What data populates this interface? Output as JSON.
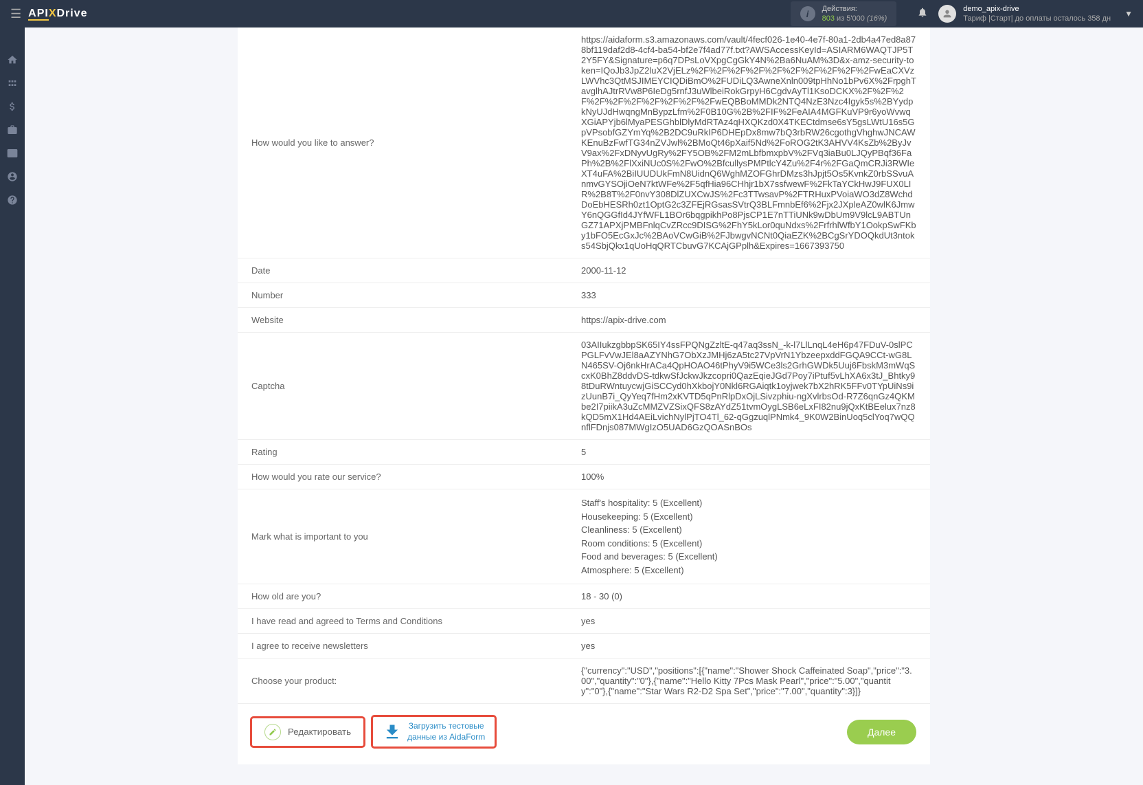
{
  "header": {
    "logo_api": "API",
    "logo_x": "X",
    "logo_drive": "Drive",
    "actions_label": "Действия:",
    "actions_count": "803",
    "actions_of": " из ",
    "actions_total": "5'000",
    "actions_pct": " (16%)",
    "user_name": "demo_apix-drive",
    "user_tariff": "Тариф |Старт| до оплаты осталось 358 дн"
  },
  "rows": [
    {
      "label": "How would you like to answer?",
      "value": "https://aidaform.s3.amazonaws.com/vault/4fecf026-1e40-4e7f-80a1-2db4a47ed8a878bf119daf2d8-4cf4-ba54-bf2e7f4ad77f.txt?AWSAccessKeyId=ASIARM6WAQTJP5T2Y5FY&Signature=p6q7DPsLoVXpgCgGkY4N%2Ba6NuAM%3D&x-amz-security-token=IQoJb3JpZ2luX2VjELz%2F%2F%2F%2F%2F%2F%2F%2F%2F%2FwEaCXVzLWVhc3QtMSJIMEYCIQDiBmO%2FUDiLQ3AwneXnln009tpHhNo1bPv6X%2FrpghTavglhAJtrRVw8P6IeDg5rnfJ3uWlbeiRokGrpyH6CgdvAyTl1KsoDCKX%2F%2F%2F%2F%2F%2F%2F%2F%2F%2FwEQBBoMMDk2NTQ4NzE3Nzc4Igyk5s%2BYydpkNyUJdHwqngMnBypzLfm%2F0B10G%2B%2FIF%2FeAIA4MGFKuVP9r6yoWvwqXGiAPYjb6lMyaPESGhblDlyMdRTAz4qHXQKzd0X4TKECtdmse6sY5gsLWtU16s5GpVPsobfGZYmYq%2B2DC9uRkIP6DHEpDx8mw7bQ3rbRW26cgothgVhghwJNCAWKEnuBzFwfTG34nZVJwl%2BMoQt46pXaif5Nd%2FoROG2tK3AHVV4KsZb%2ByJvV9ax%2FxDNyvUgRy%2FY5OB%2FM2mLbfbmxpbV%2FVq3iaBu0LJQyPBqf36FaPh%2B%2FlXxiNUc0S%2FwO%2BfcullysPMPtlcY4Zu%2F4r%2FGaQmCRJi3RWIeXT4uFA%2BiIUUDUkFmN8UidnQ6WghMZOFGhrDMzs3hJpjt5Os5KvnkZ0rbSSvuAnmvGYSOjiOeN7ktWFe%2F5qfHia96CHhjr1bX7ssfwewF%2FkTaYCkHwJ9FUX0LIR%2B8T%2F0nvY308DlZUXCwJS%2Fc3TTwsavP%2FTRHuxPVoiaWO3dZ8WchdDoEbHESRh0zt1OptG2c3ZFEjRGsasSVtrQ3BLFmnbEf6%2Fjx2JXpleAZ0wlK6JmwY6nQGGfId4JYfWFL1BOr6bqgpikhPo8PjsCP1E7nTTiUNk9wDbUm9V9lcL9ABTUnGZ71APXjPMBFnlqCvZRcc9DISG%2FhY5kLor0quNdxs%2FrfrhlWfbY1OokpSwFKby1bFO5EcGxJc%2BAoVCwGiB%2FJbwgvNCNt0QiaEZK%2BCgSrYDOQkdUt3ntoks54SbjQkx1qUoHqQRTCbuvG7KCAjGPplh&Expires=1667393750"
    },
    {
      "label": "Date",
      "value": "2000-11-12"
    },
    {
      "label": "Number",
      "value": "333"
    },
    {
      "label": "Website",
      "value": "https://apix-drive.com"
    },
    {
      "label": "Captcha",
      "value": "03AIIukzgbbpSK65IY4ssFPQNgZzltE-q47aq3ssN_-k-l7LlLnqL4eH6p47FDuV-0slPCPGLFvVwJEl8aAZYNhG7ObXzJMHj6zA5tc27VpVrN1YbzeepxddFGQA9CCt-wG8LN465SV-Oj6nkHrACa4QpHOAO46tPhyV9i5WCe3ls2GrhGWDk5Uuj6FbskM3mWqScxK0BhZ8ddvDS-tdkwSfJckwJkzcopri0QazEqieJGd7Poy7iPtuf5vLhXA6x3tJ_Bhtky98tDuRWntuycwjGiSCCyd0hXkbojY0Nkl6RGAiqtk1oyjwek7bX2hRK5FFv0TYpUiNs9izUunB7i_QyYeq7fHm2xKVTD5qPnRlpDxOjLSivzphiu-ngXvlrbsOd-R7Z6qnGz4QKMbe2I7piikA3uZcMMZVZSixQFS8zAYdZ51tvmOygLSB6eLxFI82nu9jQxKtBEelux7nz8kQD5mX1Hd4AEiLvichNylPjTO4Tl_62-qGgzuqlPNmk4_9K0W2BinUoq5clYoq7wQQnflFDnjs087MWgIzO5UAD6GzQOASnBOs"
    },
    {
      "label": "Rating",
      "value": "5"
    },
    {
      "label": "How would you rate our service?",
      "value": "100%"
    },
    {
      "label": "Mark what is important to you",
      "value": "Staff's hospitality: 5 (Excellent)\nHousekeeping: 5 (Excellent)\nCleanliness: 5 (Excellent)\nRoom conditions: 5 (Excellent)\nFood and beverages: 5 (Excellent)\nAtmosphere: 5 (Excellent)"
    },
    {
      "label": "How old are you?",
      "value": "18 - 30 (0)"
    },
    {
      "label": "I have read and agreed to Terms and Conditions",
      "value": "yes"
    },
    {
      "label": "I agree to receive newsletters",
      "value": "yes"
    },
    {
      "label": "Choose your product:",
      "value": "{\"currency\":\"USD\",\"positions\":[{\"name\":\"Shower Shock Caffeinated Soap\",\"price\":\"3.00\",\"quantity\":\"0\"},{\"name\":\"Hello Kitty 7Pcs Mask Pearl\",\"price\":\"5.00\",\"quantity\":\"0\"},{\"name\":\"Star Wars R2-D2 Spa Set\",\"price\":\"7.00\",\"quantity\":3}]}"
    }
  ],
  "buttons": {
    "edit": "Редактировать",
    "download_line1": "Загрузить тестовые",
    "download_line2": "данные из AidaForm",
    "next": "Далее"
  }
}
